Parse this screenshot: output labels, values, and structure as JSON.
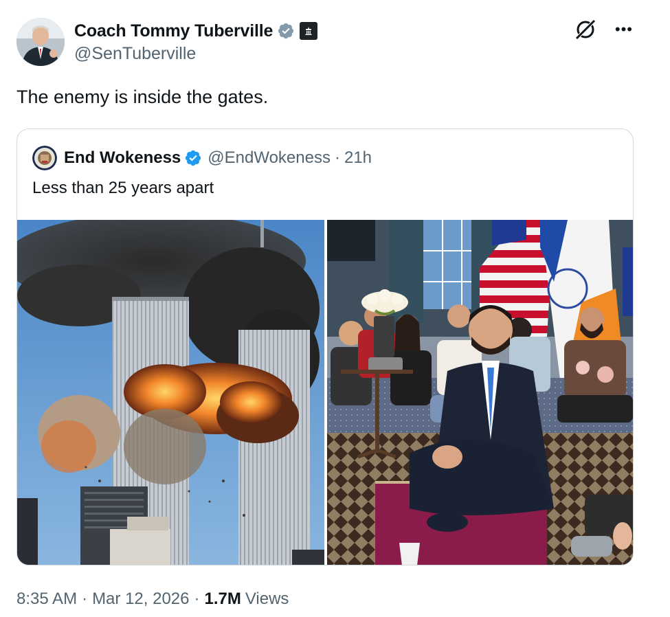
{
  "author": {
    "display_name": "Coach Tommy Tuberville",
    "handle": "@SenTuberville",
    "verified_color": "#829aab"
  },
  "tweet": {
    "text": "The enemy is inside the gates."
  },
  "quoted": {
    "display_name": "End Wokeness",
    "handle": "@EndWokeness",
    "separator": "·",
    "time": "21h",
    "text": "Less than 25 years apart",
    "verified_color": "#1d9bf0"
  },
  "meta": {
    "time": "8:35 AM",
    "separator": "·",
    "date": "Mar 12, 2026",
    "views_count": "1.7M",
    "views_label": "Views"
  },
  "icons": {
    "grok": "grok-icon",
    "more": "more-icon",
    "verified": "verified-badge-icon",
    "government": "government-building-icon"
  }
}
